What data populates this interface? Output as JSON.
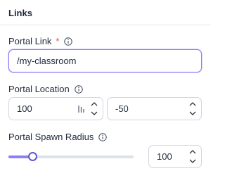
{
  "section": {
    "title": "Links"
  },
  "portal_link": {
    "label": "Portal Link",
    "required_marker": "*",
    "value": "/my-classroom"
  },
  "portal_location": {
    "label": "Portal Location",
    "x_value": "100",
    "y_value": "-50"
  },
  "portal_spawn_radius": {
    "label": "Portal Spawn Radius",
    "value": "100",
    "slider_fraction": 0.19
  },
  "colors": {
    "accent": "#6452d8",
    "required": "#e5484d",
    "border": "#cfd6e0"
  },
  "icons": [
    "info-icon",
    "chevron-up-icon",
    "chevron-down-icon",
    "drag-handle-icon"
  ]
}
